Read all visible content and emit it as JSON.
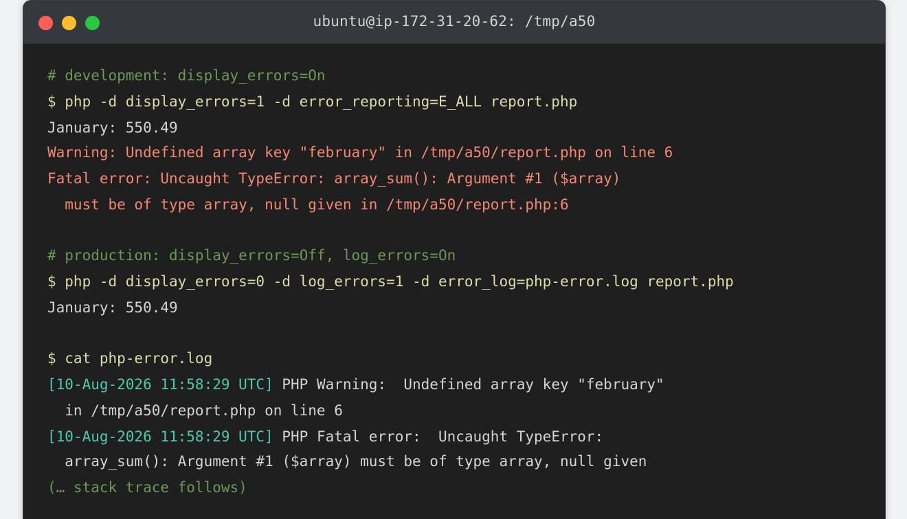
{
  "window": {
    "title": "ubuntu@ip-172-31-20-62: /tmp/a50"
  },
  "colors": {
    "comment": "#6a9955",
    "command": "#dcdcaa",
    "output": "#d4d4d4",
    "error": "#f48771",
    "timestamp": "#4ec9b0",
    "background": "#1f1f1f",
    "titlebar": "#35383c"
  },
  "lines": {
    "l1": "# development: display_errors=On",
    "l2": "$ php -d display_errors=1 -d error_reporting=E_ALL report.php",
    "l3": "January: 550.49",
    "l4": "Warning: Undefined array key \"february\" in /tmp/a50/report.php on line 6",
    "l5": "Fatal error: Uncaught TypeError: array_sum(): Argument #1 ($array)",
    "l6": "  must be of type array, null given in /tmp/a50/report.php:6",
    "l7": "# production: display_errors=Off, log_errors=On",
    "l8": "$ php -d display_errors=0 -d log_errors=1 -d error_log=php-error.log report.php",
    "l9": "January: 550.49",
    "l10": "$ cat php-error.log",
    "l11_ts": "[10-Aug-2026 11:58:29 UTC]",
    "l11_msg": " PHP Warning:  Undefined array key \"february\"",
    "l12": "  in /tmp/a50/report.php on line 6",
    "l13_ts": "[10-Aug-2026 11:58:29 UTC]",
    "l13_msg": " PHP Fatal error:  Uncaught TypeError:",
    "l14": "  array_sum(): Argument #1 ($array) must be of type array, null given",
    "l15": "(… stack trace follows)"
  }
}
